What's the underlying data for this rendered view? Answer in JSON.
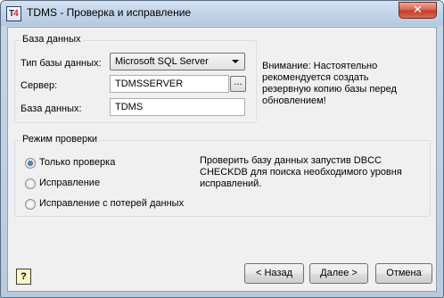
{
  "window": {
    "title": "TDMS - Проверка и исправление",
    "close_glyph": "✕",
    "app_icon_letters": "T",
    "app_icon_digit": "4"
  },
  "database_group": {
    "title": "База данных",
    "type_label": "Тип базы данных:",
    "type_value": "Microsoft SQL Server",
    "server_label": "Сервер:",
    "server_value": "TDMSSERVER",
    "browse_label": "...",
    "db_label": "База данных:",
    "db_value": "TDMS"
  },
  "warning_text": "Внимание: Настоятельно рекомендуется создать резервную копию базы перед обновлением!",
  "mode_group": {
    "title": "Режим проверки",
    "options": [
      {
        "label": "Только проверка",
        "selected": true
      },
      {
        "label": "Исправление",
        "selected": false
      },
      {
        "label": "Исправление с потерей данных",
        "selected": false
      }
    ],
    "description": "Проверить базу данных запустив DBCC CHECKDB для поиска необходимого уровня исправлений."
  },
  "footer": {
    "help_label": "?",
    "back_label": "< Назад",
    "next_label": "Далее >",
    "cancel_label": "Отмена"
  },
  "colors": {
    "client_bg": "#f0f0f0",
    "title_bg": "#c2d5ea",
    "close_red": "#c33b24"
  }
}
